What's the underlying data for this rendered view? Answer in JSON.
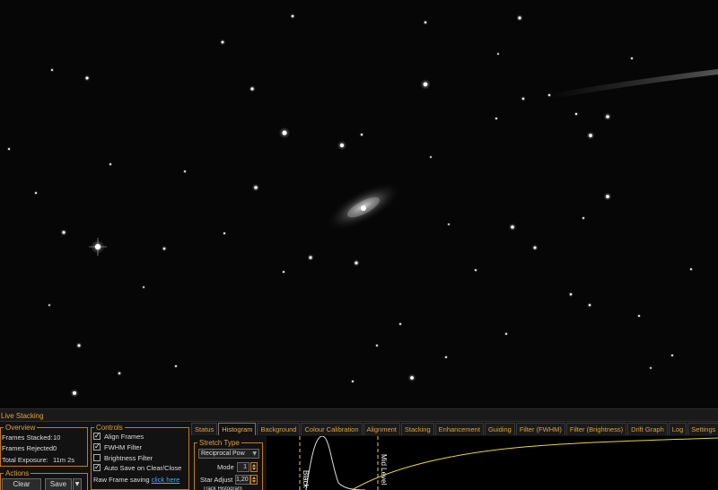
{
  "panel": {
    "title": "Live Stacking",
    "overview": {
      "label": "Overview",
      "frames_stacked_label": "Frames Stacked:",
      "frames_stacked_value": "10",
      "frames_rejected_label": "Frames Rejected:",
      "frames_rejected_value": "0",
      "total_exposure_label": "Total Exposure:",
      "total_exposure_value": "11m 2s"
    },
    "actions": {
      "label": "Actions",
      "clear_label": "Clear",
      "save_label": "Save"
    },
    "controls": {
      "label": "Controls",
      "items": [
        {
          "label": "Align Frames",
          "checked": true
        },
        {
          "label": "FWHM Filter",
          "checked": true
        },
        {
          "label": "Brightness Filter",
          "checked": false
        },
        {
          "label": "Auto Save on Clear/Close",
          "checked": true
        }
      ],
      "raw_frame_text": "Raw Frame saving",
      "raw_frame_link": "click here"
    },
    "tabs": [
      "Status",
      "Histogram",
      "Background",
      "Colour Calibration",
      "Alignment",
      "Stacking",
      "Enhancement",
      "Guiding",
      "Filter (FWHM)",
      "Filter (Brightness)",
      "Drift Graph",
      "Log",
      "Settings"
    ],
    "active_tab": "Histogram",
    "stretch": {
      "label": "Stretch Type",
      "type_value": "Reciprocal Pow",
      "mode_label": "Mode",
      "mode_value": "1",
      "star_adjust_label": "Star Adjust",
      "star_adjust_value": "1,20",
      "track_histogram_label": "Track Histogram"
    },
    "histogram": {
      "black_level_label": "Black L",
      "mid_level_label": "Mid Level",
      "marker_color": "#e8d440",
      "curve_color": "#e8d440",
      "histogram_color": "#dddddd"
    }
  },
  "colors": {
    "accent": "#e0a040",
    "group_border": "#c07a20",
    "link": "#4ea3ff"
  }
}
